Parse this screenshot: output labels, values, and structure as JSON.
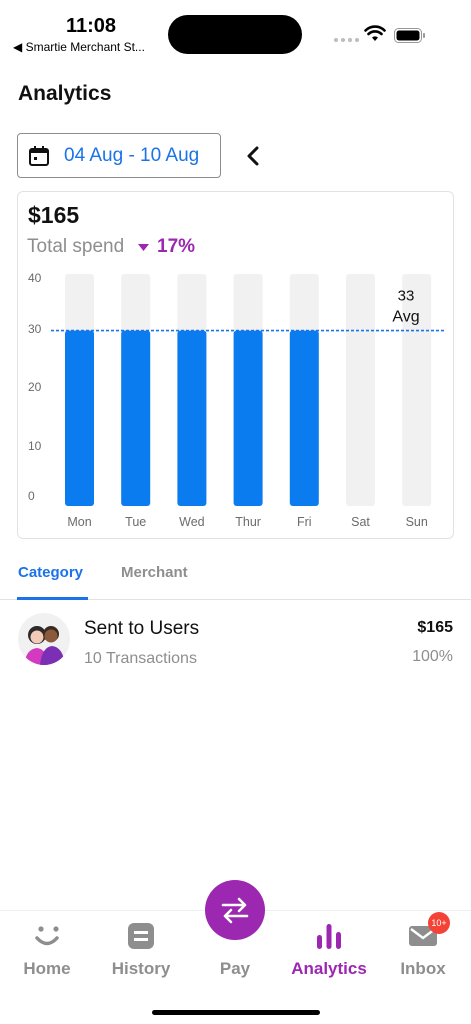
{
  "status_bar": {
    "time": "11:08",
    "back_app": "◀ Smartie Merchant St..."
  },
  "header": {
    "title": "Analytics"
  },
  "date_range": {
    "label": "04 Aug - 10 Aug"
  },
  "summary": {
    "amount": "$165",
    "label": "Total spend",
    "change_pct": "17%",
    "colors": {
      "accent": "#1a73e8",
      "change": "#9c27b0"
    }
  },
  "chart_data": {
    "type": "bar",
    "categories": [
      "Mon",
      "Tue",
      "Wed",
      "Thur",
      "Fri",
      "Sat",
      "Sun"
    ],
    "values": [
      33,
      33,
      33,
      33,
      33,
      0,
      0
    ],
    "y_ticks": [
      0,
      10,
      20,
      30,
      40
    ],
    "ylim": [
      0,
      40
    ],
    "average": {
      "value": 33,
      "value_label": "33",
      "label": "Avg"
    },
    "bar_color": "#0a7cf0",
    "track_color": "#f1f1f1",
    "avg_line_color": "#1a73e8"
  },
  "tabs": [
    {
      "label": "Category",
      "active": true
    },
    {
      "label": "Merchant",
      "active": false
    }
  ],
  "category_rows": [
    {
      "title": "Sent to Users",
      "subtitle": "10 Transactions",
      "amount": "$165",
      "percent": "100%",
      "icon": "users-avatar-icon"
    }
  ],
  "bottom_nav": {
    "items": [
      {
        "label": "Home",
        "icon": "smile-icon"
      },
      {
        "label": "History",
        "icon": "history-icon"
      },
      {
        "label": "Pay",
        "icon": "transfer-arrows-icon"
      },
      {
        "label": "Analytics",
        "icon": "bar-chart-icon",
        "active": true
      },
      {
        "label": "Inbox",
        "icon": "mail-icon"
      }
    ],
    "inbox_badge": "10+",
    "active_color": "#9c27b0"
  }
}
